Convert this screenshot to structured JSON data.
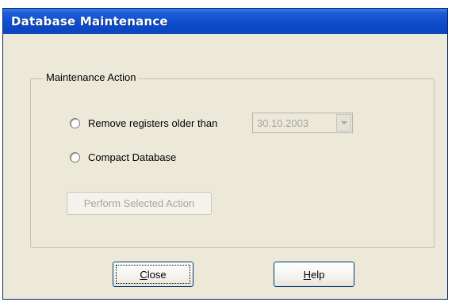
{
  "window": {
    "title": "Database Maintenance"
  },
  "group": {
    "legend": "Maintenance Action",
    "options": [
      {
        "label": "Remove registers older than",
        "selected": false
      },
      {
        "label": "Compact Database",
        "selected": false
      }
    ],
    "date": {
      "value": "30.10.2003",
      "enabled": false
    },
    "perform_button": {
      "label": "Perform Selected Action",
      "enabled": false
    }
  },
  "buttons": {
    "close": {
      "mnemonic": "C",
      "rest": "lose"
    },
    "help": {
      "mnemonic": "H",
      "rest": "elp"
    }
  },
  "colors": {
    "titlebar": "#0a46c4",
    "face": "#ece9d8",
    "disabled_text": "#a7a59c"
  },
  "icons": {
    "dropdown": "chevron-down-icon"
  }
}
